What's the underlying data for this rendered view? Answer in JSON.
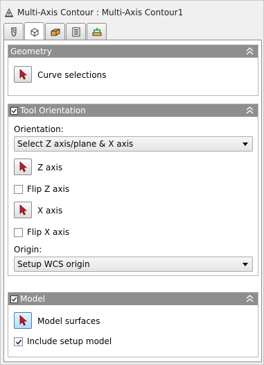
{
  "window": {
    "title": "Multi-Axis Contour : Multi-Axis Contour1"
  },
  "tabs": [
    {
      "icon": "tool-icon",
      "active": false
    },
    {
      "icon": "geometry-tab-icon",
      "active": true
    },
    {
      "icon": "heights-icon",
      "active": false
    },
    {
      "icon": "passes-icon",
      "active": false
    },
    {
      "icon": "linking-icon",
      "active": false
    }
  ],
  "geometry": {
    "header": "Geometry",
    "curve_selections_label": "Curve selections"
  },
  "tool_orientation": {
    "header": "Tool Orientation",
    "enabled": true,
    "orientation_label": "Orientation:",
    "orientation_value": "Select Z axis/plane & X axis",
    "z_axis_label": "Z axis",
    "flip_z_label": "Flip Z axis",
    "flip_z_checked": false,
    "x_axis_label": "X axis",
    "flip_x_label": "Flip X axis",
    "flip_x_checked": false,
    "origin_label": "Origin:",
    "origin_value": "Setup WCS origin"
  },
  "model": {
    "header": "Model",
    "enabled": true,
    "model_surfaces_label": "Model surfaces",
    "include_setup_label": "Include setup model",
    "include_setup_checked": true
  },
  "colors": {
    "group_header_bg": "#8e8e8e",
    "selection_arrow": "#c0202a",
    "active_button_blue": "#b8dcf5"
  }
}
